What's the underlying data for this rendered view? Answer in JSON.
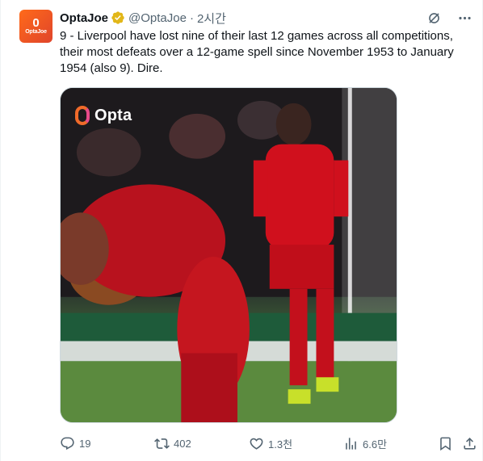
{
  "author": {
    "name": "OptaJoe",
    "handle": "@OptaJoe",
    "separator": "·",
    "time": "2시간",
    "avatar_big": "0",
    "avatar_small": "OptaJoe"
  },
  "tweet_text": "9 - Liverpool have lost nine of their last 12 games across all competitions, their most defeats over a 12-game spell since November 1953 to January 1954 (also 9). Dire.",
  "media": {
    "watermark": "Opta"
  },
  "actions": {
    "replies": "19",
    "retweets": "402",
    "likes": "1.3천",
    "views": "6.6만"
  },
  "icons": [
    "verified-badge-icon",
    "grok-icon",
    "more-icon",
    "reply-icon",
    "retweet-icon",
    "like-icon",
    "views-icon",
    "bookmark-icon",
    "share-icon"
  ],
  "colors": {
    "verified": "#e2b719",
    "text_secondary": "#536471",
    "brand_orange": "#f06a2a"
  }
}
